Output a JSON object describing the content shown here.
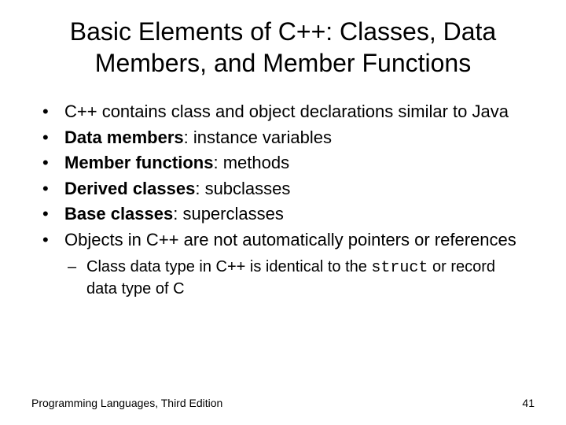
{
  "title": "Basic Elements of C++: Classes, Data Members, and Member Functions",
  "bullets": {
    "b1": "C++ contains class and object declarations similar to Java",
    "b2_bold": "Data members",
    "b2_rest": ": instance variables",
    "b3_bold": "Member functions",
    "b3_rest": ": methods",
    "b4_bold": "Derived classes",
    "b4_rest": ": subclasses",
    "b5_bold": "Base classes",
    "b5_rest": ": superclasses",
    "b6": "Objects in C++ are not automatically pointers or references"
  },
  "sub": {
    "s1_pre": "Class data type in C++ is identical to the ",
    "s1_code": "struct",
    "s1_post": " or record data type of C"
  },
  "footer": {
    "left": "Programming Languages, Third Edition",
    "right": "41"
  },
  "dot": "•",
  "dash": "–"
}
